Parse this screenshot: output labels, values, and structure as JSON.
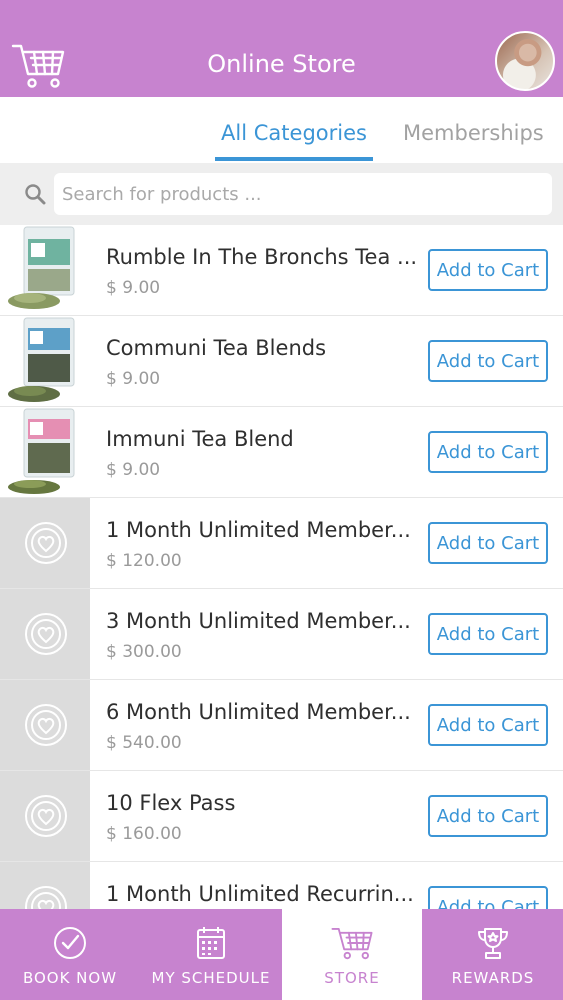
{
  "header": {
    "title": "Online Store",
    "cart_icon": "shopping-cart-icon",
    "avatar": "user-avatar"
  },
  "tabs": [
    {
      "label": "All Categories",
      "active": true
    },
    {
      "label": "Memberships",
      "active": false
    }
  ],
  "search": {
    "placeholder": "Search for products ...",
    "value": "",
    "icon": "search-icon"
  },
  "products": [
    {
      "name": "Rumble In The Bronchs Tea ...",
      "price": "$ 9.00",
      "button": "Add to Cart",
      "thumb": "tea-bag-green"
    },
    {
      "name": "Communi Tea Blends",
      "price": "$ 9.00",
      "button": "Add to Cart",
      "thumb": "tea-bag-blue"
    },
    {
      "name": "Immuni Tea Blend",
      "price": "$ 9.00",
      "button": "Add to Cart",
      "thumb": "tea-bag-pink"
    },
    {
      "name": "1 Month Unlimited Member...",
      "price": "$ 120.00",
      "button": "Add to Cart",
      "thumb": "placeholder-logo"
    },
    {
      "name": "3 Month Unlimited Member...",
      "price": "$ 300.00",
      "button": "Add to Cart",
      "thumb": "placeholder-logo"
    },
    {
      "name": "6 Month Unlimited Member...",
      "price": "$ 540.00",
      "button": "Add to Cart",
      "thumb": "placeholder-logo"
    },
    {
      "name": "10 Flex Pass",
      "price": "$ 160.00",
      "button": "Add to Cart",
      "thumb": "placeholder-logo"
    },
    {
      "name": "1 Month Unlimited Recurrin...",
      "price": "",
      "button": "Add to Cart",
      "thumb": "placeholder-logo"
    }
  ],
  "nav": [
    {
      "label": "BOOK NOW",
      "icon": "check-circle-icon",
      "active": false
    },
    {
      "label": "MY SCHEDULE",
      "icon": "calendar-icon",
      "active": false
    },
    {
      "label": "STORE",
      "icon": "shopping-cart-icon",
      "active": true
    },
    {
      "label": "REWARDS",
      "icon": "trophy-icon",
      "active": false
    }
  ],
  "colors": {
    "brand": "#c783cf",
    "accent": "#3b95d6",
    "placeholder_bg": "#dcdcdc"
  }
}
